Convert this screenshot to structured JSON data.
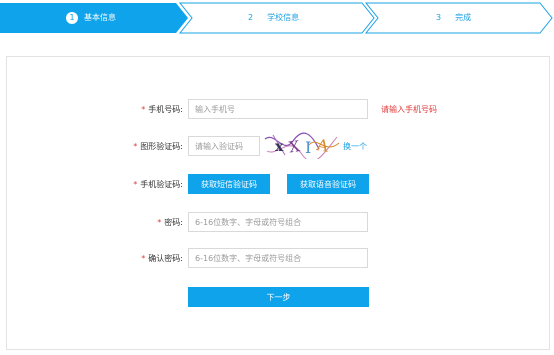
{
  "steps": [
    {
      "number": "1",
      "label": "基本信息",
      "state": "active"
    },
    {
      "number": "2",
      "label": "学校信息",
      "state": "pending"
    },
    {
      "number": "3",
      "label": "完成",
      "state": "pending"
    }
  ],
  "colors": {
    "accent": "#0ea3ea",
    "error": "#e23b3b",
    "border": "#d9d9d9"
  },
  "form": {
    "required_mark": "*",
    "phone": {
      "label": "手机号码:",
      "placeholder": "输入手机号",
      "error": "请输入手机号码"
    },
    "image_code": {
      "label": "图形验证码:",
      "placeholder": "请输入验证码",
      "captcha_text": "xXIA",
      "change_link": "换一个"
    },
    "sms_code": {
      "label": "手机验证码:",
      "sms_button": "获取短信验证码",
      "voice_button": "获取语音验证码"
    },
    "password": {
      "label": "密码:",
      "placeholder": "6-16位数字、字母或符号组合"
    },
    "confirm_password": {
      "label": "确认密码:",
      "placeholder": "6-16位数字、字母或符号组合"
    },
    "next_button": "下一步"
  }
}
